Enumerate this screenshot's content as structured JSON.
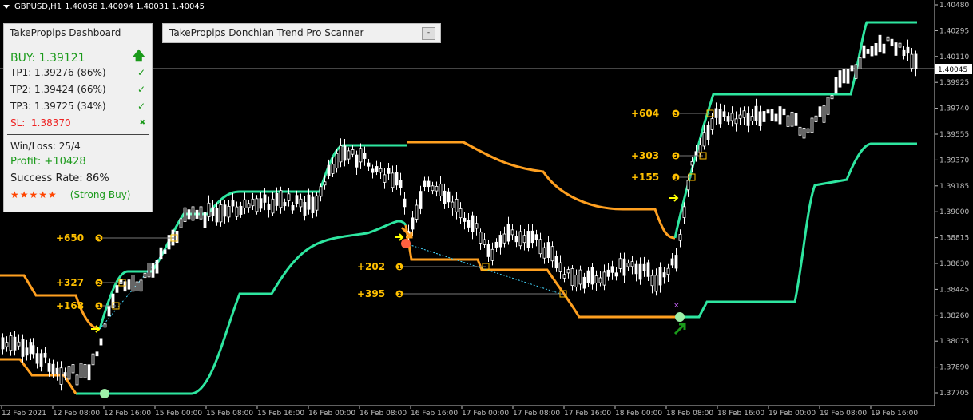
{
  "symbol_info": {
    "symbol": "GBPUSD,H1",
    "ohlc": "1.40058 1.40094 1.40031 1.40045"
  },
  "dashboard": {
    "title": "TakePropips Dashboard",
    "buy": "BUY: 1.39121",
    "tp1": "TP1: 1.39276 (86%)",
    "tp2": "TP2: 1.39424 (66%)",
    "tp3": "TP3: 1.39725 (34%)",
    "sl_label": "SL:",
    "sl_value": "1.38370",
    "winloss": "Win/Loss: 25/4",
    "profit": "Profit: +10428",
    "success": "Success Rate: 86%",
    "stars": "★★★★★",
    "strength": "(Strong Buy)",
    "check_glyph": "✓",
    "cross_glyph": "✖",
    "arrow_glyph": "🡅"
  },
  "scanner": {
    "title": "TakePropips Donchian Trend Pro Scanner",
    "min_label": "-"
  },
  "chart_data": {
    "type": "candlestick",
    "price_axis": {
      "ticks": [
        "1.40480",
        "1.40295",
        "1.40110",
        "1.39925",
        "1.39740",
        "1.39555",
        "1.39370",
        "1.39185",
        "1.39000",
        "1.38815",
        "1.38630",
        "1.38445",
        "1.38260",
        "1.38075",
        "1.37890",
        "1.37705"
      ],
      "current": "1.40045"
    },
    "time_axis": {
      "ticks": [
        "12 Feb 2021",
        "12 Feb 08:00",
        "12 Feb 16:00",
        "15 Feb 00:00",
        "15 Feb 08:00",
        "15 Feb 16:00",
        "16 Feb 00:00",
        "16 Feb 08:00",
        "16 Feb 16:00",
        "17 Feb 00:00",
        "17 Feb 08:00",
        "17 Feb 16:00",
        "18 Feb 00:00",
        "18 Feb 08:00",
        "18 Feb 16:00",
        "19 Feb 00:00",
        "19 Feb 08:00",
        "19 Feb 16:00"
      ]
    },
    "annotations": [
      {
        "text": "+650",
        "circle": "3"
      },
      {
        "text": "+327",
        "circle": "2"
      },
      {
        "text": "+168",
        "circle": "1"
      },
      {
        "text": "+202",
        "circle": "1"
      },
      {
        "text": "+395",
        "circle": "2"
      },
      {
        "text": "+604",
        "circle": "3"
      },
      {
        "text": "+303",
        "circle": "2"
      },
      {
        "text": "+155",
        "circle": "1"
      }
    ],
    "colors": {
      "upper_band": "#2ee6a0",
      "lower_band": "#ffa020",
      "candle": "#ffffff",
      "label": "#ffc000",
      "axis": "#c0c0c0"
    }
  }
}
